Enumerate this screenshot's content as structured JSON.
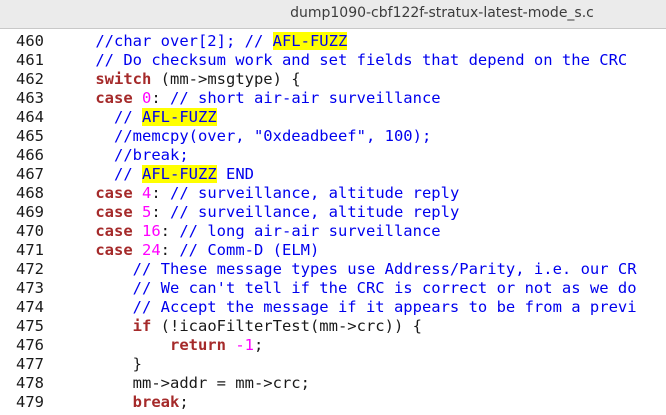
{
  "tab": {
    "title": "dump1090-cbf122f-stratux-latest-mode_s.c"
  },
  "editor": {
    "lines": [
      {
        "number": "460",
        "tokens": [
          {
            "type": "comment",
            "text": "    //char over[2]; // "
          },
          {
            "type": "highlight",
            "text": "AFL-FUZZ"
          }
        ]
      },
      {
        "number": "461",
        "tokens": [
          {
            "type": "comment",
            "text": "    // Do checksum work and set fields that depend on the CRC"
          }
        ]
      },
      {
        "number": "462",
        "tokens": [
          {
            "type": "plain",
            "text": "    "
          },
          {
            "type": "keyword",
            "text": "switch"
          },
          {
            "type": "plain",
            "text": " (mm->msgtype) {"
          }
        ]
      },
      {
        "number": "463",
        "tokens": [
          {
            "type": "plain",
            "text": "    "
          },
          {
            "type": "keyword",
            "text": "case"
          },
          {
            "type": "plain",
            "text": " "
          },
          {
            "type": "number",
            "text": "0"
          },
          {
            "type": "plain",
            "text": ": "
          },
          {
            "type": "comment",
            "text": "// short air-air surveillance"
          }
        ]
      },
      {
        "number": "464",
        "tokens": [
          {
            "type": "comment",
            "text": "      // "
          },
          {
            "type": "highlight",
            "text": "AFL-FUZZ"
          }
        ]
      },
      {
        "number": "465",
        "tokens": [
          {
            "type": "comment",
            "text": "      //memcpy(over, \"0xdeadbeef\", 100);"
          }
        ]
      },
      {
        "number": "466",
        "tokens": [
          {
            "type": "comment",
            "text": "      //break;"
          }
        ]
      },
      {
        "number": "467",
        "tokens": [
          {
            "type": "comment",
            "text": "      // "
          },
          {
            "type": "highlight",
            "text": "AFL-FUZZ"
          },
          {
            "type": "comment",
            "text": " END"
          }
        ]
      },
      {
        "number": "468",
        "tokens": [
          {
            "type": "plain",
            "text": "    "
          },
          {
            "type": "keyword",
            "text": "case"
          },
          {
            "type": "plain",
            "text": " "
          },
          {
            "type": "number",
            "text": "4"
          },
          {
            "type": "plain",
            "text": ": "
          },
          {
            "type": "comment",
            "text": "// surveillance, altitude reply"
          }
        ]
      },
      {
        "number": "469",
        "tokens": [
          {
            "type": "plain",
            "text": "    "
          },
          {
            "type": "keyword",
            "text": "case"
          },
          {
            "type": "plain",
            "text": " "
          },
          {
            "type": "number",
            "text": "5"
          },
          {
            "type": "plain",
            "text": ": "
          },
          {
            "type": "comment",
            "text": "// surveillance, altitude reply"
          }
        ]
      },
      {
        "number": "470",
        "tokens": [
          {
            "type": "plain",
            "text": "    "
          },
          {
            "type": "keyword",
            "text": "case"
          },
          {
            "type": "plain",
            "text": " "
          },
          {
            "type": "number",
            "text": "16"
          },
          {
            "type": "plain",
            "text": ": "
          },
          {
            "type": "comment",
            "text": "// long air-air surveillance"
          }
        ]
      },
      {
        "number": "471",
        "tokens": [
          {
            "type": "plain",
            "text": "    "
          },
          {
            "type": "keyword",
            "text": "case"
          },
          {
            "type": "plain",
            "text": " "
          },
          {
            "type": "number",
            "text": "24"
          },
          {
            "type": "plain",
            "text": ": "
          },
          {
            "type": "comment",
            "text": "// Comm-D (ELM)"
          }
        ]
      },
      {
        "number": "472",
        "tokens": [
          {
            "type": "comment",
            "text": "        // These message types use Address/Parity, i.e. our CR"
          }
        ]
      },
      {
        "number": "473",
        "tokens": [
          {
            "type": "comment",
            "text": "        // We can't tell if the CRC is correct or not as we do"
          }
        ]
      },
      {
        "number": "474",
        "tokens": [
          {
            "type": "comment",
            "text": "        // Accept the message if it appears to be from a previ"
          }
        ]
      },
      {
        "number": "475",
        "tokens": [
          {
            "type": "plain",
            "text": "        "
          },
          {
            "type": "keyword",
            "text": "if"
          },
          {
            "type": "plain",
            "text": " (!icaoFilterTest(mm->crc)) {"
          }
        ]
      },
      {
        "number": "476",
        "tokens": [
          {
            "type": "plain",
            "text": "            "
          },
          {
            "type": "keyword",
            "text": "return"
          },
          {
            "type": "plain",
            "text": " "
          },
          {
            "type": "number",
            "text": "-1"
          },
          {
            "type": "plain",
            "text": ";"
          }
        ]
      },
      {
        "number": "477",
        "tokens": [
          {
            "type": "plain",
            "text": "        }"
          }
        ]
      },
      {
        "number": "478",
        "tokens": [
          {
            "type": "plain",
            "text": "        mm->addr = mm->crc;"
          }
        ]
      },
      {
        "number": "479",
        "tokens": [
          {
            "type": "plain",
            "text": "        "
          },
          {
            "type": "keyword",
            "text": "break"
          },
          {
            "type": "plain",
            "text": ";"
          }
        ]
      }
    ]
  }
}
